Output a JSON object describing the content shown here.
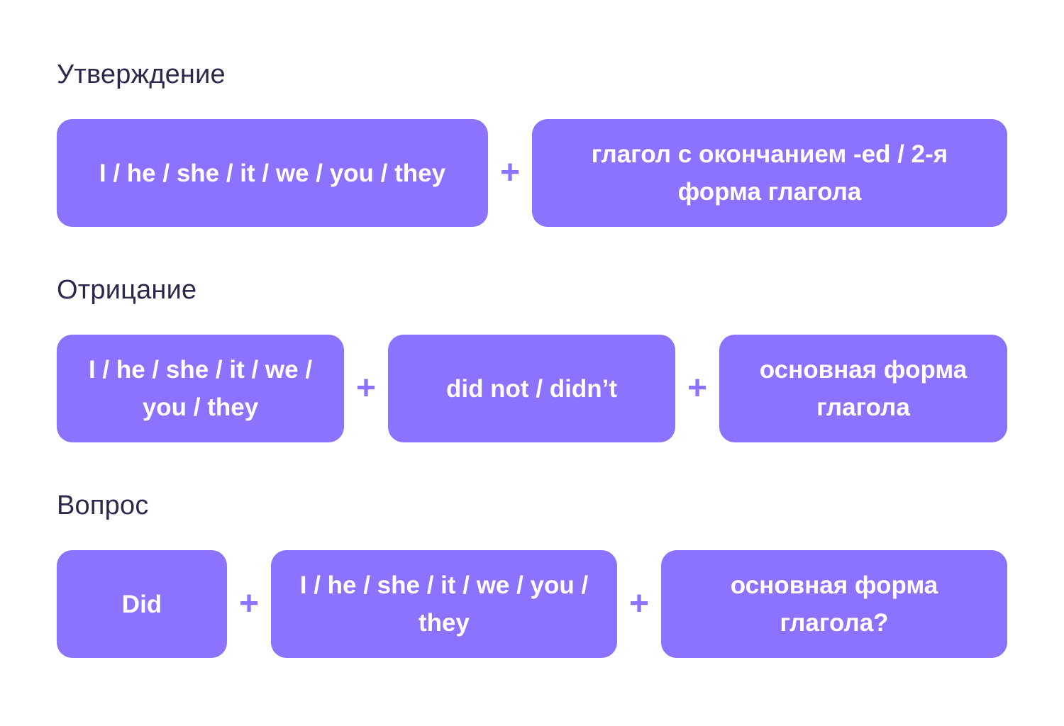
{
  "accent_color": "#8c73ff",
  "heading_color": "#2b2a4c",
  "plus_symbol": "+",
  "sections": [
    {
      "title": "Утверждение",
      "boxes": [
        "I / he / she / it / we / you / they",
        "глагол с окончанием -ed / 2-я форма глагола"
      ]
    },
    {
      "title": "Отрицание",
      "boxes": [
        "I / he / she / it / we / you / they",
        "did not / didn’t",
        "основная форма глагола"
      ]
    },
    {
      "title": "Вопрос",
      "boxes": [
        "Did",
        "I / he / she / it / we / you / they",
        "основная форма глагола?"
      ]
    }
  ]
}
